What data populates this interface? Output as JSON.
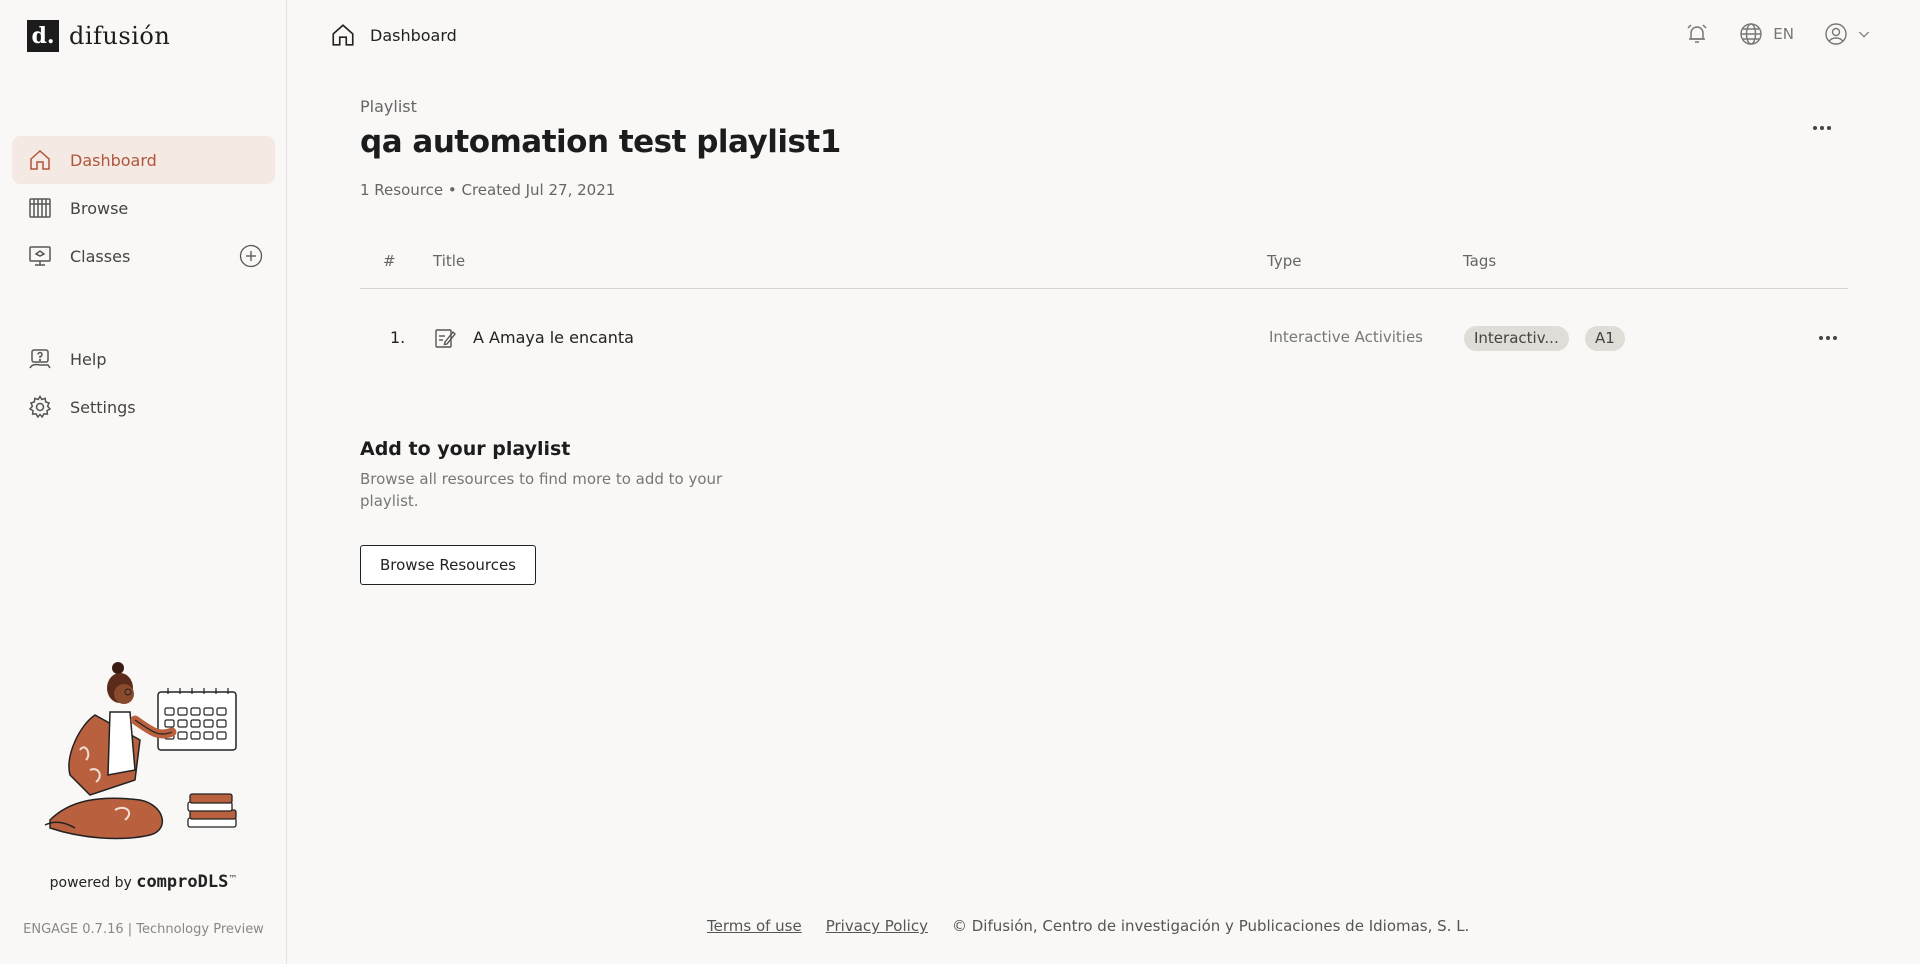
{
  "brand": {
    "mark": "d.",
    "name": "difusión"
  },
  "sidebar": {
    "items": [
      {
        "label": "Dashboard",
        "icon": "home-icon",
        "active": true
      },
      {
        "label": "Browse",
        "icon": "library-icon"
      },
      {
        "label": "Classes",
        "icon": "classroom-icon"
      },
      {
        "label": "Help",
        "icon": "help-icon"
      },
      {
        "label": "Settings",
        "icon": "gear-icon"
      }
    ],
    "powered_prefix": "powered by",
    "powered_brand": "comproDLS",
    "powered_tm": "™",
    "version": "ENGAGE 0.7.16 | Technology Preview"
  },
  "topbar": {
    "breadcrumb": "Dashboard",
    "language": "EN"
  },
  "playlist": {
    "section_label": "Playlist",
    "title": "qa automation test playlist1",
    "meta": "1 Resource • Created Jul 27, 2021",
    "columns": {
      "num": "#",
      "title": "Title",
      "type": "Type",
      "tags": "Tags"
    },
    "rows": [
      {
        "num": "1.",
        "title": "A Amaya le encanta",
        "type": "Interactive Activities",
        "tags": [
          "Interactiv...",
          "A1"
        ]
      }
    ]
  },
  "add_section": {
    "title": "Add to your playlist",
    "description": "Browse all resources to find more to add to your playlist.",
    "button": "Browse Resources"
  },
  "footer": {
    "terms": "Terms of use",
    "privacy": "Privacy Policy",
    "copyright": "© Difusión, Centro de investigación y Publicaciones de Idiomas, S. L."
  },
  "colors": {
    "accent": "#b0553a",
    "active_bg": "#f5e9e4",
    "background": "#f9f8f6"
  }
}
